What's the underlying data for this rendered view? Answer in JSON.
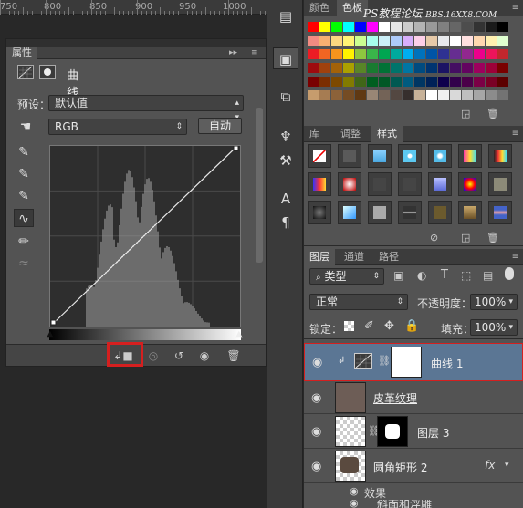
{
  "ruler": {
    "labels": [
      "750",
      "800",
      "850",
      "900",
      "950",
      "1000"
    ]
  },
  "properties": {
    "tab_label": "属性",
    "panel_title": "曲线",
    "preset_label": "预设：",
    "preset_value": "默认值",
    "channel_value": "RGB",
    "auto_button": "自动"
  },
  "watermark": {
    "text": "PS教程论坛",
    "url": "BBS.16XX8.COM"
  },
  "swatches_panel": {
    "tabs": [
      "颜色",
      "色板"
    ],
    "colors": [
      [
        "#ff0000",
        "#ffff00",
        "#00ff00",
        "#00ffff",
        "#0000ff",
        "#ff00ff",
        "#ffffff",
        "#e6e6e6",
        "#cccccc",
        "#b3b3b3",
        "#999999",
        "#808080",
        "#666666",
        "#4d4d4d",
        "#333333",
        "#1a1a1a",
        "#000000"
      ],
      [
        "#f28b82",
        "#f7b071",
        "#fcd77f",
        "#fff475",
        "#ccff90",
        "#a7ffeb",
        "#cbf0f8",
        "#aecbfa",
        "#d7aefb",
        "#fdcfe8",
        "#e6c9a8",
        "#e8eaed",
        "#ffffff",
        "#ffe0e0",
        "#ffd8b0",
        "#fff0b0",
        "#e0ffd0"
      ],
      [
        "#ed1c24",
        "#f26522",
        "#f7941d",
        "#fff200",
        "#8dc63f",
        "#39b54a",
        "#00a651",
        "#00a99d",
        "#00aeef",
        "#0072bc",
        "#0054a6",
        "#2e3192",
        "#662d91",
        "#92278f",
        "#ec008c",
        "#ed145b",
        "#c1272d"
      ],
      [
        "#9e0b0f",
        "#a0410d",
        "#a36209",
        "#aba000",
        "#598527",
        "#197b30",
        "#007236",
        "#00746b",
        "#0076a3",
        "#004b80",
        "#003471",
        "#1b1464",
        "#440e62",
        "#630460",
        "#9e005d",
        "#9e0039",
        "#790000"
      ],
      [
        "#790000",
        "#7b2e00",
        "#7d4900",
        "#827b00",
        "#406618",
        "#005e20",
        "#005826",
        "#005952",
        "#005b7f",
        "#003663",
        "#002157",
        "#0d004c",
        "#32004b",
        "#4b0049",
        "#7b0046",
        "#7a0026",
        "#5c0000"
      ],
      [
        "#c69c6d",
        "#a67c52",
        "#8c6239",
        "#754c24",
        "#603913",
        "#998675",
        "#736357",
        "#534741",
        "#362f2d",
        "#c7b299",
        "#ffffff",
        "#f0f0f0",
        "#d9d9d9",
        "#bfbfbf",
        "#a6a6a6",
        "#8c8c8c",
        "#737373"
      ]
    ]
  },
  "styles_panel": {
    "tabs": [
      "库",
      "调整",
      "样式"
    ]
  },
  "layers_panel": {
    "tabs": [
      "图层",
      "通道",
      "路径"
    ],
    "filter_label": "类型",
    "blend_mode": "正常",
    "opacity_label": "不透明度：",
    "opacity_value": "100%",
    "lock_label": "锁定：",
    "fill_label": "填充：",
    "fill_value": "100%",
    "layers": [
      {
        "name": "曲线 1"
      },
      {
        "name": "皮革纹理"
      },
      {
        "name": "图层 3"
      },
      {
        "name": "圆角矩形 2",
        "fx": "fx"
      }
    ],
    "effects_label": "效果",
    "sub_effect_label": "斜面和浮雕"
  },
  "colors": {
    "highlight_red": "#d51f1f",
    "selected_layer": "#5b7694"
  }
}
